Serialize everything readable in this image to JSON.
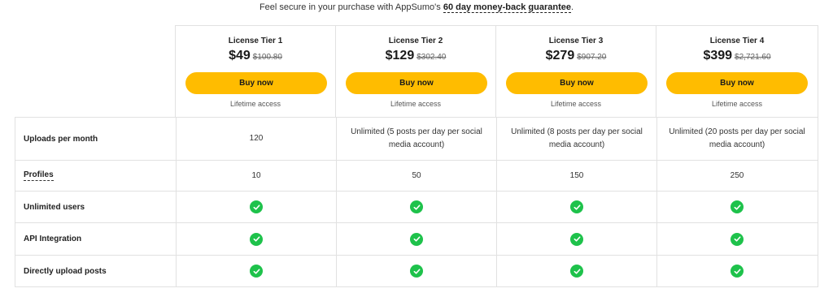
{
  "banner": {
    "prefix": "Feel secure in your purchase with AppSumo's ",
    "highlight": "60 day money-back guarantee",
    "suffix": "."
  },
  "tiers": [
    {
      "name": "License Tier 1",
      "price": "$49",
      "old_price": "$100.80",
      "button": "Buy now",
      "access": "Lifetime access"
    },
    {
      "name": "License Tier 2",
      "price": "$129",
      "old_price": "$302.40",
      "button": "Buy now",
      "access": "Lifetime access"
    },
    {
      "name": "License Tier 3",
      "price": "$279",
      "old_price": "$907.20",
      "button": "Buy now",
      "access": "Lifetime access"
    },
    {
      "name": "License Tier 4",
      "price": "$399",
      "old_price": "$2,721.60",
      "button": "Buy now",
      "access": "Lifetime access"
    }
  ],
  "features": [
    {
      "label": "Uploads per month",
      "values": [
        "120",
        "Unlimited (5 posts per day per social media account)",
        "Unlimited (8 posts per day per social media account)",
        "Unlimited (20 posts per day per social media account)"
      ]
    },
    {
      "label": "Profiles",
      "values": [
        "10",
        "50",
        "150",
        "250"
      ]
    },
    {
      "label": "Unlimited users",
      "values": [
        "check-icon",
        "check-icon",
        "check-icon",
        "check-icon"
      ]
    },
    {
      "label": "API Integration",
      "values": [
        "check-icon",
        "check-icon",
        "check-icon",
        "check-icon"
      ]
    },
    {
      "label": "Directly upload posts",
      "values": [
        "check-icon",
        "check-icon",
        "check-icon",
        "check-icon"
      ]
    }
  ],
  "colors": {
    "button": "#ffbc00",
    "check": "#1ec24b",
    "border": "#e1e1e1"
  }
}
